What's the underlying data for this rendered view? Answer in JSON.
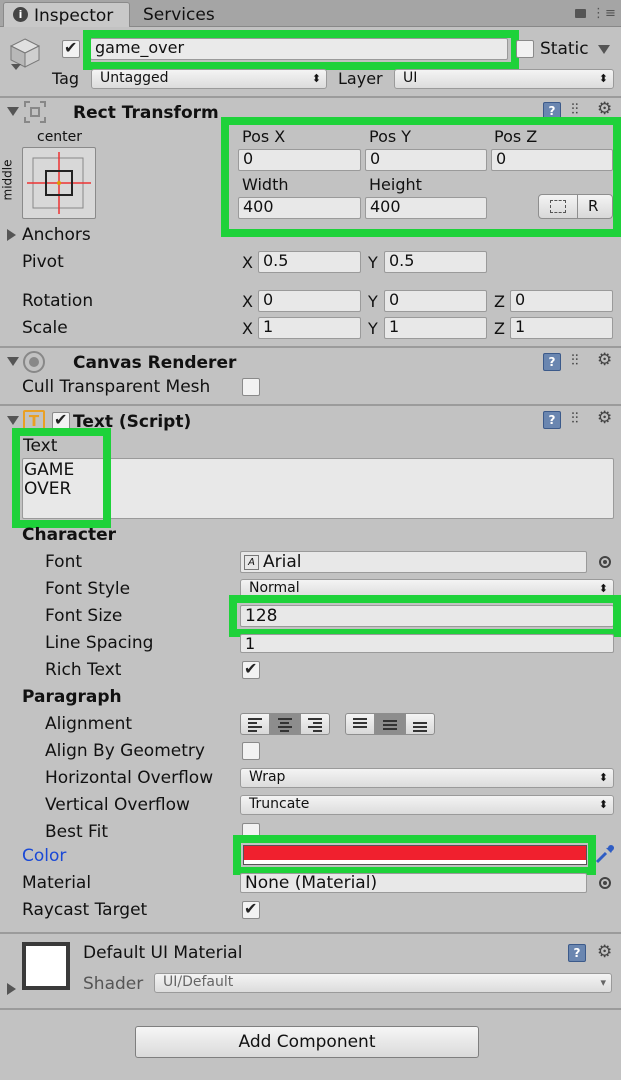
{
  "tabs": [
    {
      "label": "Inspector",
      "active": true
    },
    {
      "label": "Services",
      "active": false
    }
  ],
  "header": {
    "object_name": "game_over",
    "active": true,
    "static_label": "Static",
    "tag_label": "Tag",
    "tag_value": "Untagged",
    "layer_label": "Layer",
    "layer_value": "UI"
  },
  "rect_transform": {
    "title": "Rect Transform",
    "anchor_h": "center",
    "anchor_v": "middle",
    "pos_x_label": "Pos X",
    "pos_x": "0",
    "pos_y_label": "Pos Y",
    "pos_y": "0",
    "pos_z_label": "Pos Z",
    "pos_z": "0",
    "width_label": "Width",
    "width": "400",
    "height_label": "Height",
    "height": "400",
    "raw_button": "R",
    "anchors_label": "Anchors",
    "pivot_label": "Pivot",
    "pivot_x": "0.5",
    "pivot_y": "0.5",
    "rotation_label": "Rotation",
    "rot_x": "0",
    "rot_y": "0",
    "rot_z": "0",
    "scale_label": "Scale",
    "scale_x": "1",
    "scale_y": "1",
    "scale_z": "1",
    "x_label": "X",
    "y_label": "Y",
    "z_label": "Z"
  },
  "canvas_renderer": {
    "title": "Canvas Renderer",
    "cull_label": "Cull Transparent Mesh",
    "cull_checked": false
  },
  "text_script": {
    "title": "Text (Script)",
    "text_label": "Text",
    "text_line1": "GAME",
    "text_line2": "OVER",
    "character_label": "Character",
    "font_label": "Font",
    "font_value": "Arial",
    "font_style_label": "Font Style",
    "font_style_value": "Normal",
    "font_size_label": "Font Size",
    "font_size_value": "128",
    "line_spacing_label": "Line Spacing",
    "line_spacing_value": "1",
    "rich_text_label": "Rich Text",
    "rich_text_checked": true,
    "paragraph_label": "Paragraph",
    "alignment_label": "Alignment",
    "align_by_geometry_label": "Align By Geometry",
    "align_by_geometry_checked": false,
    "horizontal_overflow_label": "Horizontal Overflow",
    "horizontal_overflow_value": "Wrap",
    "vertical_overflow_label": "Vertical Overflow",
    "vertical_overflow_value": "Truncate",
    "best_fit_label": "Best Fit",
    "best_fit_checked": false,
    "color_label": "Color",
    "color_value": "#f0202e",
    "material_label": "Material",
    "material_value": "None (Material)",
    "raycast_label": "Raycast Target",
    "raycast_checked": true
  },
  "material_section": {
    "title": "Default UI Material",
    "shader_label": "Shader",
    "shader_value": "UI/Default"
  },
  "add_component_label": "Add Component",
  "colors": {
    "highlight": "#1ed23a",
    "label_blue": "#1a49d6",
    "color_swatch": "#f0202e"
  },
  "icons": [
    "info-icon",
    "lock-icon",
    "menu-icon",
    "cube-icon",
    "rect-transform-icon",
    "help-icon",
    "settings-icon",
    "sliders-icon",
    "canvas-renderer-icon",
    "text-component-icon",
    "font-icon",
    "object-picker-icon",
    "eyedropper-icon"
  ]
}
